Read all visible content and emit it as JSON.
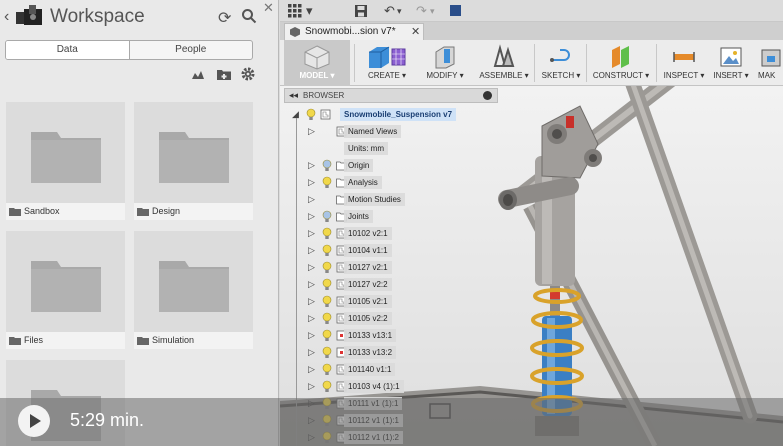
{
  "workspace": {
    "title": "Workspace",
    "tabs": [
      "Data",
      "People"
    ]
  },
  "folders": [
    {
      "name": "Sandbox"
    },
    {
      "name": "Design"
    },
    {
      "name": "Files"
    },
    {
      "name": "Simulation"
    },
    {
      "name": ""
    }
  ],
  "document": {
    "tab_title": "Snowmobi...sion v7*"
  },
  "ribbon": {
    "buttons": [
      "MODEL",
      "CREATE",
      "MODIFY",
      "ASSEMBLE",
      "SKETCH",
      "CONSTRUCT",
      "INSPECT",
      "INSERT",
      "MAK"
    ]
  },
  "browser": {
    "title": "BROWSER",
    "root": "Snowmobile_Suspension v7",
    "items": [
      "Named Views",
      "Units: mm",
      "Origin",
      "Analysis",
      "Motion Studies",
      "Joints",
      "10102 v2:1",
      "10104 v1:1",
      "10127 v2:1",
      "10127 v2:2",
      "10105 v2:1",
      "10105 v2:2",
      "10133 v13:1",
      "10133 v13:2",
      "101140 v1:1",
      "10103 v4 (1):1",
      "10111 v1 (1):1",
      "10112 v1 (1):1",
      "10112 v1 (1):2"
    ]
  },
  "video": {
    "duration": "5:29 min."
  },
  "colors": {
    "accent_blue": "#1a3e72",
    "spring_gold": "#d9a22a",
    "damper_blue": "#3a7fc4",
    "frame_gray": "#a8a5a2"
  }
}
